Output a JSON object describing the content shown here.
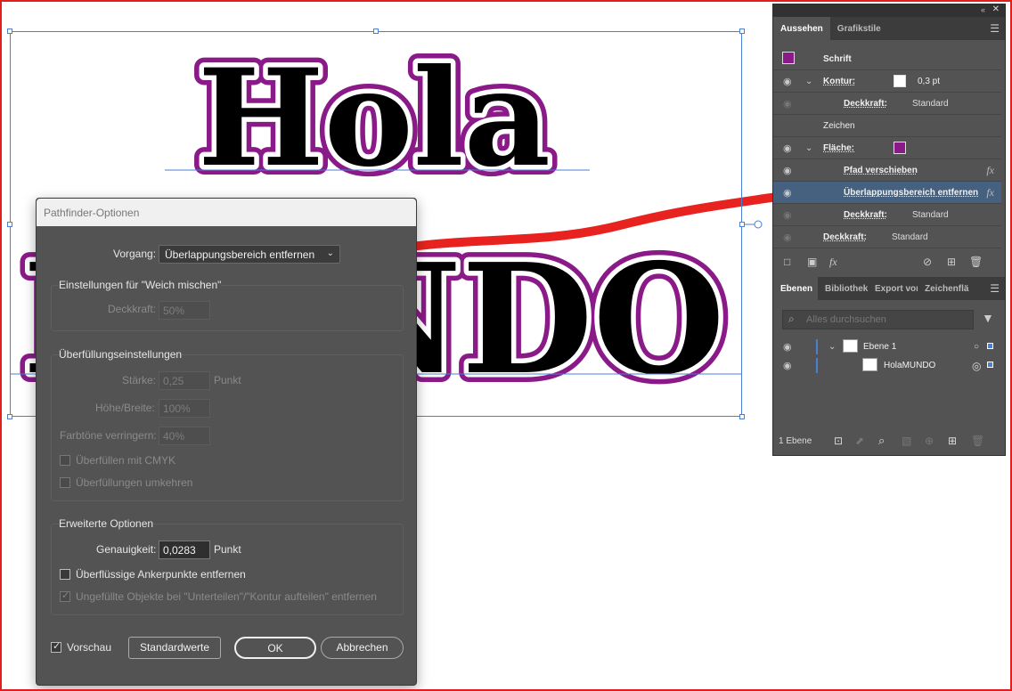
{
  "artwork": {
    "word_top": "Hola",
    "word_bottom": "MUNDO",
    "fill_color": "#8b1a89",
    "text_color": "#000000"
  },
  "dialog": {
    "title": "Pathfinder-Optionen",
    "vorgang_label": "Vorgang:",
    "vorgang_value": "Überlappungsbereich entfernen",
    "weich_group": "Einstellungen für \"Weich mischen\"",
    "deckkraft_label": "Deckkraft:",
    "deckkraft_value": "50%",
    "ueberfuellung_group": "Überfüllungseinstellungen",
    "staerke_label": "Stärke:",
    "staerke_value": "0,25",
    "staerke_unit": "Punkt",
    "hoehe_label": "Höhe/Breite:",
    "hoehe_value": "100%",
    "farbtoene_label": "Farbtöne verringern:",
    "farbtoene_value": "40%",
    "cmyk_label": "Überfüllen mit CMYK",
    "umkehren_label": "Überfüllungen umkehren",
    "erweitert_group": "Erweiterte Optionen",
    "genauigkeit_label": "Genauigkeit:",
    "genauigkeit_value": "0,0283",
    "genauigkeit_unit": "Punkt",
    "anker_label": "Überflüssige Ankerpunkte entfernen",
    "ungefuellt_label": "Ungefüllte Objekte bei \"Unterteilen\"/\"Kontur aufteilen\" entfernen",
    "vorschau_label": "Vorschau",
    "standard_button": "Standardwerte",
    "ok_button": "OK",
    "cancel_button": "Abbrechen"
  },
  "appearance_panel": {
    "tabs": [
      "Aussehen",
      "Grafikstile"
    ],
    "rows": {
      "schrift": "Schrift",
      "kontur_label": "Kontur:",
      "kontur_value": "0,3 pt",
      "kontur_deckkraft_label": "Deckkraft:",
      "kontur_deckkraft_value": "Standard",
      "zeichen": "Zeichen",
      "flaeche_label": "Fläche:",
      "pfad": "Pfad verschieben",
      "ueberlappung": "Überlappungsbereich entfernen",
      "flaeche_deckkraft_label": "Deckkraft:",
      "flaeche_deckkraft_value": "Standard",
      "deckkraft_label": "Deckkraft:",
      "deckkraft_value": "Standard"
    },
    "fx_label": "fx",
    "swatch_color": "#8b1a89"
  },
  "layers_panel": {
    "tabs": [
      "Ebenen",
      "Bibliothek",
      "Export vor",
      "Zeichenflä"
    ],
    "search_placeholder": "Alles durchsuchen",
    "layer_name": "Ebene 1",
    "object_name": "HolaMUNDO",
    "footer_count": "1 Ebene"
  }
}
